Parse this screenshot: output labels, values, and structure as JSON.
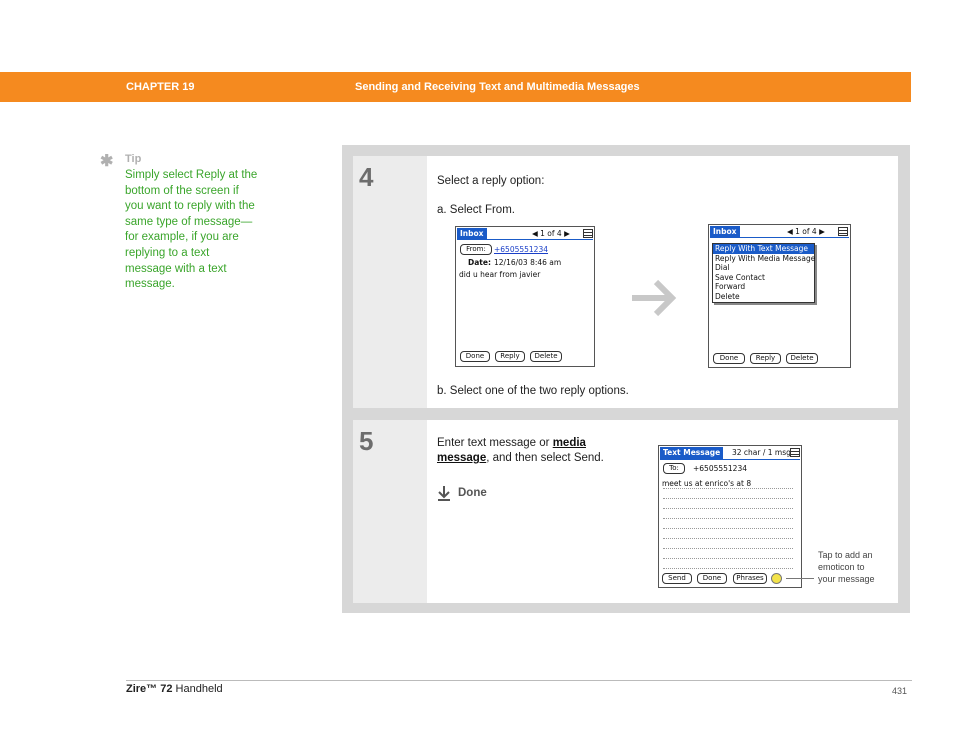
{
  "header": {
    "chapter": "CHAPTER 19",
    "title": "Sending and Receiving Text and Multimedia Messages"
  },
  "tip": {
    "icon": "asterisk-icon",
    "label": "Tip",
    "lines": [
      "Simply select Reply at the",
      "bottom of the screen if",
      "you want to reply with the",
      "same type of message—",
      "for example, if you are",
      "replying to a text",
      "message with a text",
      "message."
    ]
  },
  "step4": {
    "number": "4",
    "intro": "Select a reply option:",
    "sub_a": "a.  Select From.",
    "sub_b": "b.  Select one of the two reply options.",
    "screen1": {
      "title": "Inbox",
      "nav": "1 of 4",
      "from_btn": "From:",
      "from_value": "+6505551234",
      "date_label": "Date:",
      "date_value": "12/16/03 8:46 am",
      "body": "did u hear from javier",
      "buttons": [
        "Done",
        "Reply",
        "Delete"
      ]
    },
    "screen2": {
      "title": "Inbox",
      "nav": "1 of 4",
      "menu": [
        "Reply With Text Message",
        "Reply With Media Message",
        "Dial",
        "Save Contact",
        "Forward",
        "Delete"
      ],
      "buttons": [
        "Done",
        "Reply",
        "Delete"
      ]
    },
    "arrow_icon": "right-arrow-icon"
  },
  "step5": {
    "number": "5",
    "text_before": "Enter text message or ",
    "link_1": "media ",
    "link_2": "message",
    "text_after": ", and then select Send.",
    "done_label": "Done",
    "done_icon": "down-arrow-icon",
    "screen": {
      "title": "Text Message",
      "counter": "32 char / 1 msg",
      "to_btn": "To:",
      "to_value": "+6505551234",
      "body": "meet us at enrico's at 8",
      "buttons": [
        "Send",
        "Done",
        "Phrases"
      ]
    },
    "callout": [
      "Tap to add an",
      "emoticon to",
      "your message"
    ]
  },
  "footer": {
    "product_prefix": "Zire™ ",
    "product_model": "72",
    "product_suffix": " Handheld",
    "page": "431"
  }
}
